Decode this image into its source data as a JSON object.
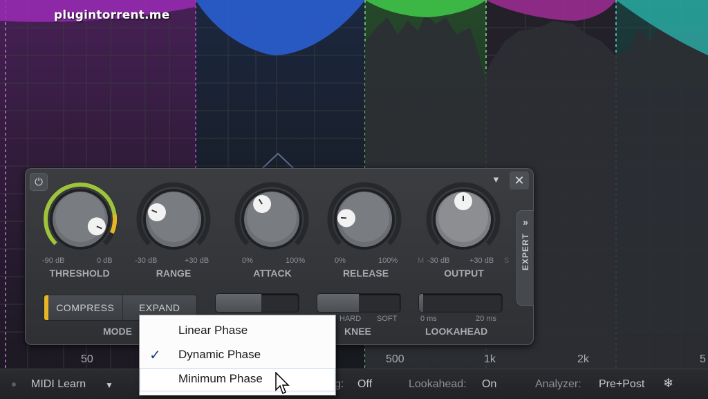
{
  "watermark": "plugintorrent.me",
  "colors": {
    "accent": "#e8b625",
    "threshold_arc": "#9ec43c",
    "band_purple": "#9a2bb5",
    "band_blue": "#2a5ed0",
    "band_green": "#40c84a",
    "band_teal": "#2bb8b0"
  },
  "spectrum": {
    "freq_labels": [
      "50",
      "500",
      "1k",
      "2k",
      "5"
    ]
  },
  "panel": {
    "power_icon": "power-icon",
    "close_icon": "close-icon",
    "knobs": [
      {
        "label": "THRESHOLD",
        "min": "-90 dB",
        "max": "0 dB",
        "value": 0.92
      },
      {
        "label": "RANGE",
        "min": "-30 dB",
        "max": "+30 dB",
        "value": 0.25
      },
      {
        "label": "ATTACK",
        "min": "0%",
        "max": "100%",
        "value": 0.38
      },
      {
        "label": "RELEASE",
        "min": "0%",
        "max": "100%",
        "value": 0.18
      },
      {
        "label": "OUTPUT",
        "min": "-30 dB",
        "max": "+30 dB",
        "value": 0.5,
        "extra_left": "M",
        "extra_right": "S"
      }
    ],
    "mode": {
      "label": "MODE",
      "options": [
        "COMPRESS",
        "EXPAND"
      ],
      "selected": "COMPRESS"
    },
    "knee": {
      "label": "KNEE",
      "min": "HARD",
      "max": "SOFT",
      "value": 0.5
    },
    "lookahead": {
      "label": "LOOKAHEAD",
      "min": "0 ms",
      "max": "20 ms",
      "value": 0.05
    },
    "mode_slider": {
      "value": 0.55
    },
    "expert_tab": {
      "label": "EXPERT",
      "arrows": "»"
    }
  },
  "status_bar": {
    "midi_learn": "MIDI Learn",
    "oversampling_label": "g:",
    "oversampling_value": "Off",
    "lookahead_label": "Lookahead:",
    "lookahead_value": "On",
    "analyzer_label": "Analyzer:",
    "analyzer_value": "Pre+Post",
    "settings_icon": "snowflake-icon"
  },
  "context_menu": {
    "items": [
      {
        "label": "Linear Phase",
        "checked": false
      },
      {
        "label": "Dynamic Phase",
        "checked": true
      },
      {
        "label": "Minimum Phase",
        "checked": false,
        "hovered": true
      }
    ]
  }
}
